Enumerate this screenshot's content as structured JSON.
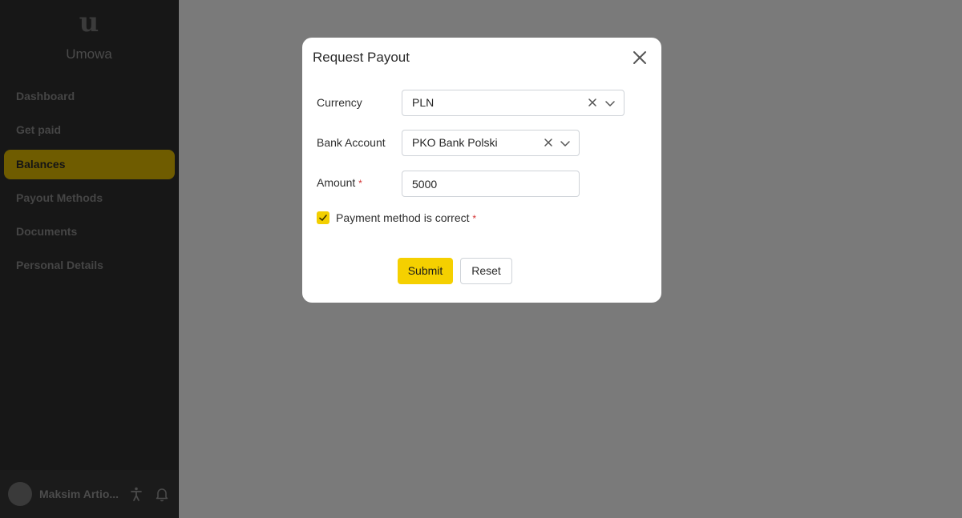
{
  "brand": {
    "logo_glyph": "u",
    "name": "Umowa"
  },
  "nav": {
    "items": [
      {
        "label": "Dashboard",
        "active": false
      },
      {
        "label": "Get paid",
        "active": false
      },
      {
        "label": "Balances",
        "active": true
      },
      {
        "label": "Payout Methods",
        "active": false
      },
      {
        "label": "Documents",
        "active": false
      },
      {
        "label": "Personal Details",
        "active": false
      }
    ]
  },
  "footer": {
    "user_name": "Maksim Artio...",
    "icons": [
      "accessibility-icon",
      "bell-icon"
    ]
  },
  "modal": {
    "title": "Request Payout",
    "currency": {
      "label": "Currency",
      "value": "PLN"
    },
    "bank_account": {
      "label": "Bank Account",
      "value": "PKO Bank Polski"
    },
    "amount": {
      "label": "Amount",
      "required_mark": "*",
      "value": "5000"
    },
    "confirm": {
      "label": "Payment method is correct",
      "required_mark": "*",
      "checked": true
    },
    "submit_label": "Submit",
    "reset_label": "Reset"
  },
  "colors": {
    "accent": "#f5d000",
    "overlay": "#7a7a7a",
    "sidebar_bg": "#171717",
    "required": "#d32f2f"
  }
}
